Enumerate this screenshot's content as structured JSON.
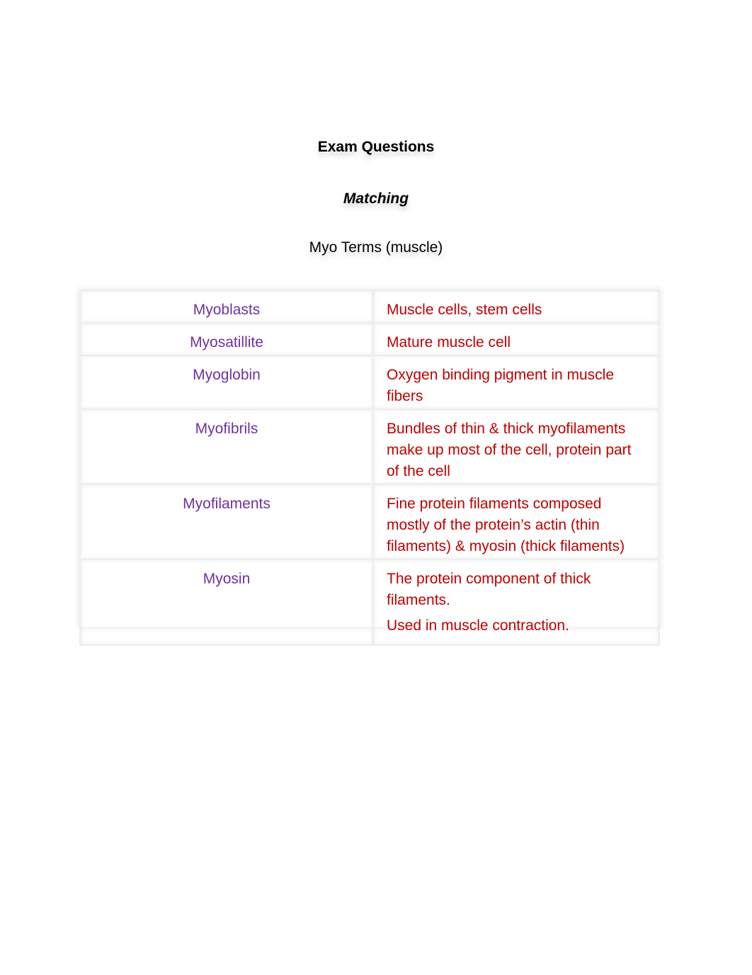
{
  "document": {
    "title": "Exam Questions",
    "subtitle": "Matching",
    "section": "Myo Terms (muscle)"
  },
  "colors": {
    "term": "#7030a0",
    "definition": "#c00000"
  },
  "table": {
    "rows": [
      {
        "term": "Myoblasts",
        "definition": [
          "Muscle cells, stem cells"
        ]
      },
      {
        "term": "Myosatillite",
        "definition": [
          "Mature muscle cell"
        ]
      },
      {
        "term": "Myoglobin",
        "definition": [
          "Oxygen binding pigment in muscle fibers"
        ]
      },
      {
        "term": "Myofibrils",
        "definition": [
          "Bundles of thin & thick myofilaments make up most of the cell, protein part of the cell"
        ]
      },
      {
        "term": "Myofilaments",
        "definition": [
          "Fine protein filaments composed mostly of the protein’s actin (thin filaments) & myosin (thick filaments)"
        ]
      },
      {
        "term": "Myosin",
        "definition": [
          "The protein component of thick filaments.",
          "Used in muscle contraction."
        ]
      }
    ]
  }
}
